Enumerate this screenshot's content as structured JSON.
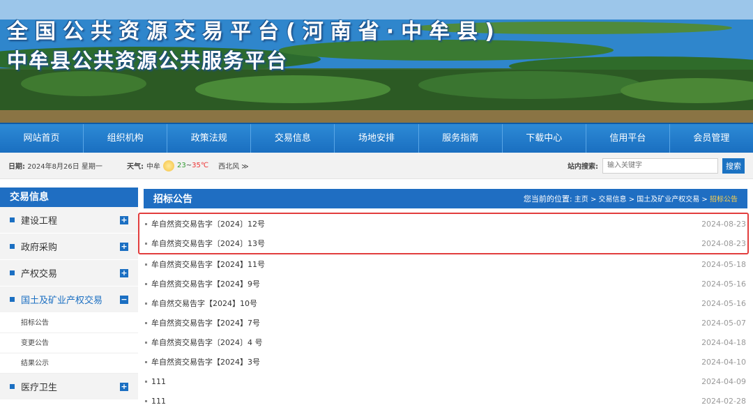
{
  "banner": {
    "title": "全国公共资源交易平台(河南省·中牟县)",
    "subtitle": "中牟县公共资源公共服务平台"
  },
  "nav": [
    "网站首页",
    "组织机构",
    "政策法规",
    "交易信息",
    "场地安排",
    "服务指南",
    "下载中心",
    "信用平台",
    "会员管理"
  ],
  "info": {
    "date_label": "日期:",
    "date_value": "2024年8月26日",
    "weekday": "星期一",
    "weather_label": "天气:",
    "city": "中牟",
    "temp_low": "23",
    "temp_sep": "~",
    "temp_high": "35℃",
    "wind": "西北风 ≫",
    "search_label": "站内搜索:",
    "search_placeholder": "输入关键字",
    "search_button": "搜索"
  },
  "sidebar": {
    "title": "交易信息",
    "items": [
      {
        "label": "建设工程",
        "icon": "+"
      },
      {
        "label": "政府采购",
        "icon": "+"
      },
      {
        "label": "产权交易",
        "icon": "+"
      },
      {
        "label": "国土及矿业产权交易",
        "icon": "−"
      }
    ],
    "sub_items": [
      "招标公告",
      "变更公告",
      "结果公示"
    ],
    "after_items": [
      {
        "label": "医疗卫生",
        "icon": "+"
      }
    ]
  },
  "main": {
    "title": "招标公告",
    "crumb_label": "您当前的位置:",
    "crumb": "主页 > 交易信息 > 国土及矿业产权交易 >",
    "crumb_current": "招标公告"
  },
  "highlighted_rows": [
    {
      "title": "牟自然资交易告字〔2024〕12号",
      "date": "2024-08-23"
    },
    {
      "title": "牟自然资交易告字〔2024〕13号",
      "date": "2024-08-23"
    }
  ],
  "rows": [
    {
      "title": "牟自然资交易告字【2024】11号",
      "date": "2024-05-18"
    },
    {
      "title": "牟自然资交易告字【2024】9号",
      "date": "2024-05-16"
    },
    {
      "title": "牟自然交易告字【2024】10号",
      "date": "2024-05-16"
    },
    {
      "title": "牟自然资交易告字【2024】7号",
      "date": "2024-05-07"
    },
    {
      "title": "牟自然资交易告字〔2024〕4 号",
      "date": "2024-04-18"
    },
    {
      "title": "牟自然资交易告字【2024】3号",
      "date": "2024-04-10"
    },
    {
      "title": "111",
      "date": "2024-04-09"
    },
    {
      "title": "111",
      "date": "2024-02-28"
    }
  ],
  "colors": {
    "nav": "#1f6ec2",
    "highlight_border": "#e23d3d",
    "crumb_current": "#ffd24a"
  }
}
